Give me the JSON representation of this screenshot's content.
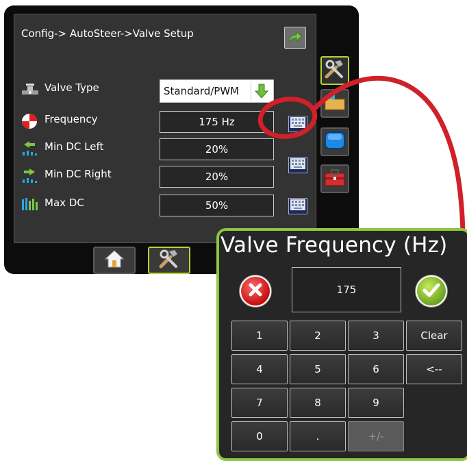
{
  "header": {
    "breadcrumb": "Config-> AutoSteer->Valve Setup",
    "back_icon": "return-arrow-icon"
  },
  "settings": [
    {
      "label": "Valve Type",
      "value": "Standard/PWM",
      "icon": "valve-icon",
      "kind": "dropdown"
    },
    {
      "label": "Frequency",
      "value": "175 Hz",
      "icon": "frequency-icon",
      "kind": "keypad"
    },
    {
      "label": "Min DC Left",
      "value": "20%",
      "icon": "min-dc-left-icon",
      "kind": "keypad"
    },
    {
      "label": "Min DC Right",
      "value": "20%",
      "icon": "min-dc-right-icon",
      "kind": "keypad"
    },
    {
      "label": "Max DC",
      "value": "50%",
      "icon": "max-dc-icon",
      "kind": "keypad"
    }
  ],
  "side_tabs": [
    "tools-icon",
    "folder-icon",
    "display-icon",
    "toolbox-icon"
  ],
  "bottom_tabs": [
    "home-icon",
    "tools-icon"
  ],
  "keypad": {
    "title": "Valve Frequency (Hz)",
    "display_value": "175",
    "keys": [
      [
        "1",
        "2",
        "3",
        "Clear"
      ],
      [
        "4",
        "5",
        "6",
        "<--"
      ],
      [
        "7",
        "8",
        "9"
      ],
      [
        "0",
        ".",
        "+/-"
      ]
    ]
  },
  "colors": {
    "accent_green": "#8dc63f",
    "callout_red": "#d0202a",
    "screen_bg": "#333333"
  }
}
